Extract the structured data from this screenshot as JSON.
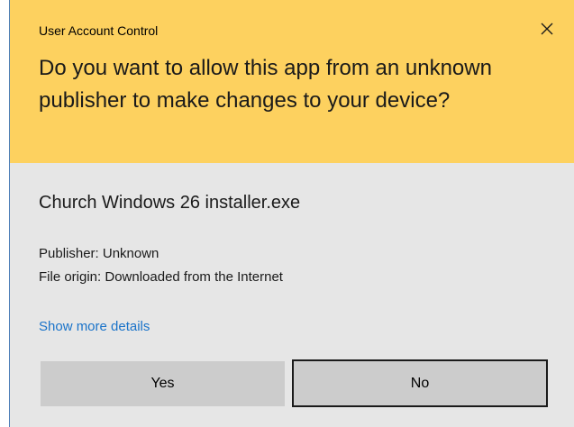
{
  "dialog": {
    "title": "User Account Control",
    "question": "Do you want to allow this app from an unknown publisher to make changes to your device?",
    "app_name": "Church Windows 26 installer.exe",
    "publisher": "Publisher: Unknown",
    "file_origin": "File origin: Downloaded from the Internet",
    "more_details_label": "Show more details",
    "yes_label": "Yes",
    "no_label": "No"
  },
  "icons": {
    "close": "close-icon"
  },
  "colors": {
    "header_bg": "#fdd15f",
    "body_bg": "#e6e6e6",
    "link": "#1a73c9",
    "button_bg": "#cccccc",
    "focus_border": "#1a1a1a",
    "window_border": "#4d7fb8"
  }
}
